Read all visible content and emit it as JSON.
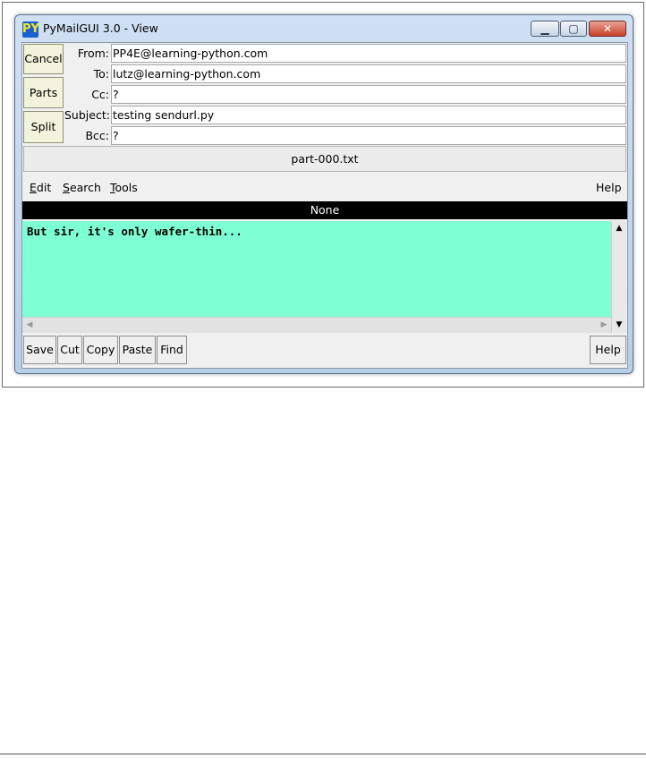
{
  "window": {
    "title": "PyMailGUI 3.0 - View",
    "icon_text": "PY",
    "controls": {
      "minimize": "▁",
      "maximize": "▢",
      "close": "✕"
    }
  },
  "side_buttons": {
    "cancel": "Cancel",
    "parts": "Parts",
    "split": "Split"
  },
  "headers": {
    "from": {
      "label": "From:",
      "value": "PP4E@learning-python.com"
    },
    "to": {
      "label": "To:",
      "value": "lutz@learning-python.com"
    },
    "cc": {
      "label": "Cc:",
      "value": "?"
    },
    "subject": {
      "label": "Subject:",
      "value": "testing sendurl.py"
    },
    "bcc": {
      "label": "Bcc:",
      "value": "?"
    }
  },
  "part_button": "part-000.txt",
  "menu": {
    "edit": {
      "first": "E",
      "rest": "dit"
    },
    "search": {
      "first": "S",
      "rest": "earch"
    },
    "tools": {
      "first": "T",
      "rest": "ools"
    },
    "help": "Help"
  },
  "black_bar": "None",
  "body_text": "But sir, it's only wafer-thin...",
  "toolbar": {
    "save": "Save",
    "cut": "Cut",
    "copy": "Copy",
    "paste": "Paste",
    "find": "Find",
    "help": "Help"
  },
  "colors": {
    "text_bg": "#7fffd4",
    "side_button_bg": "#f3f2dc",
    "black_bar_bg": "#000000"
  }
}
